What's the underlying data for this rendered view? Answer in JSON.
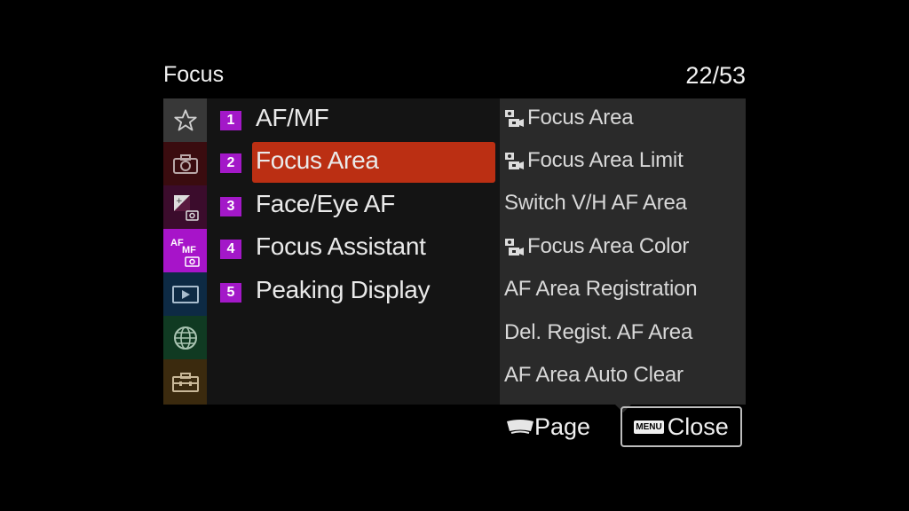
{
  "header": {
    "title": "Focus",
    "page_indicator": "22/53"
  },
  "tabs": [
    {
      "name": "star-icon",
      "bg": "#383838"
    },
    {
      "name": "camera-icon",
      "bg": "#3a0c0f"
    },
    {
      "name": "exposure-camera-icon",
      "bg": "#3b0c2c"
    },
    {
      "name": "af-mf-camera-icon",
      "bg": "#a714c9",
      "text_af": "AF",
      "text_mf": "MF",
      "selected": true
    },
    {
      "name": "playback-icon",
      "bg": "#0d2a44"
    },
    {
      "name": "globe-icon",
      "bg": "#103a22"
    },
    {
      "name": "toolbox-icon",
      "bg": "#3b2a0e"
    }
  ],
  "submenu": [
    {
      "num": "1",
      "label": "AF/MF"
    },
    {
      "num": "2",
      "label": "Focus Area",
      "selected": true
    },
    {
      "num": "3",
      "label": "Face/Eye AF"
    },
    {
      "num": "4",
      "label": "Focus Assistant"
    },
    {
      "num": "5",
      "label": "Peaking Display"
    }
  ],
  "items": [
    {
      "label": "Focus Area",
      "icon": true
    },
    {
      "label": "Focus Area Limit",
      "icon": true
    },
    {
      "label": "Switch V/H AF Area",
      "icon": false
    },
    {
      "label": "Focus Area Color",
      "icon": true
    },
    {
      "label": "AF Area Registration",
      "icon": false
    },
    {
      "label": "Del. Regist. AF Area",
      "icon": false
    },
    {
      "label": "AF Area Auto Clear",
      "icon": false
    }
  ],
  "footer": {
    "page_label": "Page",
    "menu_tag": "MENU",
    "close_label": "Close"
  },
  "colors": {
    "selected": "#bb2f13",
    "badge": "#a318c8"
  }
}
